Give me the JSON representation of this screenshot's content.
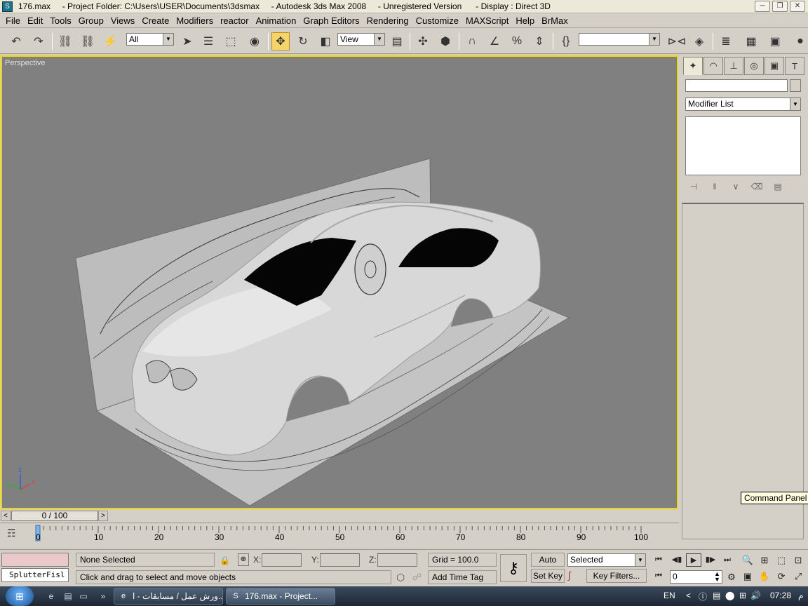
{
  "window": {
    "title": "176.max     - Project Folder: C:\\Users\\USER\\Documents\\3dsmax     - Autodesk 3ds Max 2008     - Unregistered Version      - Display : Direct 3D",
    "minimize": "─",
    "restore": "❐",
    "close": "✕"
  },
  "menu": {
    "items": [
      "File",
      "Edit",
      "Tools",
      "Group",
      "Views",
      "Create",
      "Modifiers",
      "reactor",
      "Animation",
      "Graph Editors",
      "Rendering",
      "Customize",
      "MAXScript",
      "Help",
      "BrMax"
    ]
  },
  "toolbar": {
    "selection_filter": "All",
    "ref_coord": "View",
    "named_selection": ""
  },
  "viewport": {
    "label": "Perspective",
    "axis_x": "x",
    "axis_y": "y",
    "axis_z": "z"
  },
  "command_panel": {
    "name_value": "",
    "modifier_list": "Modifier List",
    "tooltip": "Command Panel"
  },
  "timeline": {
    "slider": "0 / 100",
    "left_arrow": "<",
    "right_arrow": ">",
    "ticks": [
      "0",
      "10",
      "20",
      "30",
      "40",
      "50",
      "60",
      "70",
      "80",
      "90",
      "100"
    ]
  },
  "status": {
    "maxscript_text": "SplutterFisl",
    "selection": "None Selected",
    "prompt": "Click and drag to select and move objects",
    "x_label": "X:",
    "y_label": "Y:",
    "z_label": "Z:",
    "x_value": "",
    "y_value": "",
    "z_value": "",
    "grid": "Grid = 100.0",
    "add_time_tag": "Add Time Tag",
    "auto_key": "Auto Key",
    "set_key": "Set Key",
    "key_mode": "Selected",
    "key_filters": "Key Filters...",
    "current_frame": "0"
  },
  "taskbar": {
    "tasks": [
      {
        "label": "ورش عمل / مسابقات - ا...",
        "icon": "ie-icon"
      },
      {
        "label": "176.max     - Project...",
        "icon": "3dsmax-icon"
      }
    ],
    "lang": "EN",
    "time": "07:28",
    "ampm": "م"
  },
  "colors": {
    "viewport_bg": "#808080",
    "active_border": "#f2d600",
    "ui_bg": "#d4d0c8",
    "tooltip_bg": "#ffffe1"
  }
}
